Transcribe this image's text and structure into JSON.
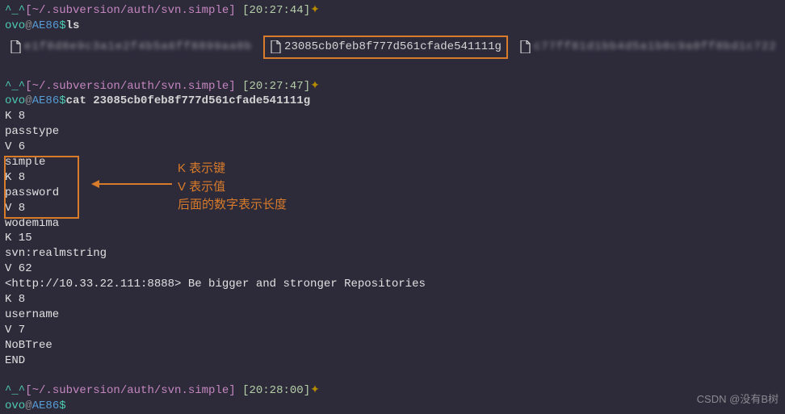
{
  "colors": {
    "accent": "#d87b2a",
    "cyan": "#4ec9b0",
    "purple": "#c586c0",
    "yellow": "#b5cea8"
  },
  "prompt1": {
    "prefix": "^_^",
    "path": "[~/.subversion/auth/svn.simple]",
    "time": "[20:27:44]",
    "diamond": "✦",
    "user": "ovo",
    "at": "@",
    "host": "AE86",
    "sep": "$",
    "cmd": "ls"
  },
  "ls": {
    "item1": "e1f8d8e9c3a1e2f4b5a6ff8899aa0b",
    "item2": "23085cb0feb8f777d561cfade541111g",
    "item3": "c77ff81d1bb4d5a1b0c9a0ff8bd1c722"
  },
  "prompt2": {
    "prefix": "^_^",
    "path": "[~/.subversion/auth/svn.simple]",
    "time": "[20:27:47]",
    "diamond": "✦",
    "user": "ovo",
    "at": "@",
    "host": "AE86",
    "sep": "$",
    "cmd": "cat 23085cb0feb8f777d561cfade541111g"
  },
  "output": {
    "l1": "K 8",
    "l2": "passtype",
    "l3": "V 6",
    "l4": "simple",
    "l5": "K 8",
    "l6": "password",
    "l7": "V 8",
    "l8": "wodemima",
    "l9": "K 15",
    "l10": "svn:realmstring",
    "l11": "V 62",
    "l12": "<http://10.33.22.111:8888> Be bigger and stronger Repositories",
    "l13": "K 8",
    "l14": "username",
    "l15": "V 7",
    "l16": "NoBTree",
    "l17": "END"
  },
  "prompt3": {
    "prefix": "^_^",
    "path": "[~/.subversion/auth/svn.simple]",
    "time": "[20:28:00]",
    "diamond": "✦",
    "user": "ovo",
    "at": "@",
    "host": "AE86",
    "sep": "$"
  },
  "annotation": {
    "l1": "K 表示键",
    "l2": "V 表示值",
    "l3": "后面的数字表示长度"
  },
  "watermark": "CSDN @没有B树"
}
